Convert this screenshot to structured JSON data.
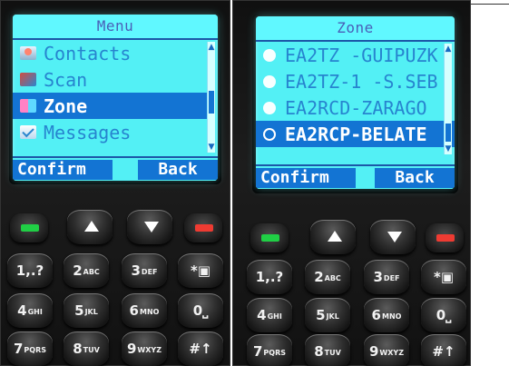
{
  "left_screen": {
    "title": "Menu",
    "items": [
      {
        "label": "Contacts",
        "icon": "contacts-icon"
      },
      {
        "label": "Scan",
        "icon": "scan-icon"
      },
      {
        "label": "Zone",
        "icon": "zone-icon"
      },
      {
        "label": "Messages",
        "icon": "messages-icon"
      }
    ],
    "selected": "Zone",
    "confirm_label": "Confirm",
    "back_label": "Back"
  },
  "right_screen": {
    "title": "Zone",
    "items": [
      {
        "label": "EA2TZ -GUIPUZK"
      },
      {
        "label": "EA2TZ-1 -S.SEB"
      },
      {
        "label": "EA2RCD-ZARAGO"
      },
      {
        "label": "EA2RCP-BELATE"
      }
    ],
    "selected": "EA2RCP-BELATE",
    "confirm_label": "Confirm",
    "back_label": "Back"
  },
  "keypad": {
    "number_keys": [
      {
        "main": "1,.?",
        "sub": ""
      },
      {
        "main": "2",
        "sub": "ABC"
      },
      {
        "main": "3",
        "sub": "DEF"
      },
      {
        "main": "*",
        "sub": "lock"
      },
      {
        "main": "4",
        "sub": "GHI"
      },
      {
        "main": "5",
        "sub": "JKL"
      },
      {
        "main": "6",
        "sub": "MNO"
      },
      {
        "main": "0",
        "sub": "space"
      },
      {
        "main": "7",
        "sub": "PQRS"
      },
      {
        "main": "8",
        "sub": "TUV"
      },
      {
        "main": "9",
        "sub": "WXYZ"
      },
      {
        "main": "#",
        "sub": "shift"
      }
    ],
    "accent_green": "#20cf45",
    "accent_red": "#ee3b32"
  }
}
